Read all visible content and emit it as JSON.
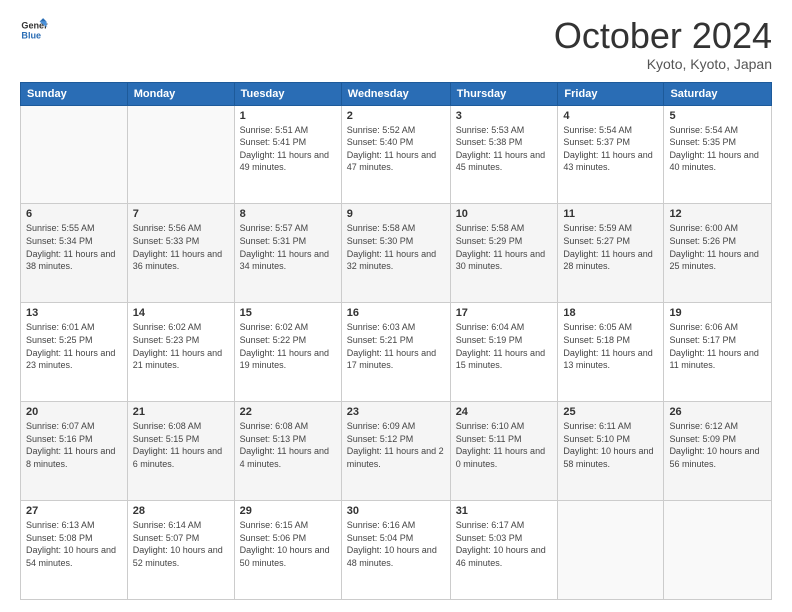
{
  "logo": {
    "line1": "General",
    "line2": "Blue"
  },
  "header": {
    "month": "October 2024",
    "location": "Kyoto, Kyoto, Japan"
  },
  "weekdays": [
    "Sunday",
    "Monday",
    "Tuesday",
    "Wednesday",
    "Thursday",
    "Friday",
    "Saturday"
  ],
  "weeks": [
    [
      {
        "day": "",
        "content": ""
      },
      {
        "day": "",
        "content": ""
      },
      {
        "day": "1",
        "content": "Sunrise: 5:51 AM\nSunset: 5:41 PM\nDaylight: 11 hours and 49 minutes."
      },
      {
        "day": "2",
        "content": "Sunrise: 5:52 AM\nSunset: 5:40 PM\nDaylight: 11 hours and 47 minutes."
      },
      {
        "day": "3",
        "content": "Sunrise: 5:53 AM\nSunset: 5:38 PM\nDaylight: 11 hours and 45 minutes."
      },
      {
        "day": "4",
        "content": "Sunrise: 5:54 AM\nSunset: 5:37 PM\nDaylight: 11 hours and 43 minutes."
      },
      {
        "day": "5",
        "content": "Sunrise: 5:54 AM\nSunset: 5:35 PM\nDaylight: 11 hours and 40 minutes."
      }
    ],
    [
      {
        "day": "6",
        "content": "Sunrise: 5:55 AM\nSunset: 5:34 PM\nDaylight: 11 hours and 38 minutes."
      },
      {
        "day": "7",
        "content": "Sunrise: 5:56 AM\nSunset: 5:33 PM\nDaylight: 11 hours and 36 minutes."
      },
      {
        "day": "8",
        "content": "Sunrise: 5:57 AM\nSunset: 5:31 PM\nDaylight: 11 hours and 34 minutes."
      },
      {
        "day": "9",
        "content": "Sunrise: 5:58 AM\nSunset: 5:30 PM\nDaylight: 11 hours and 32 minutes."
      },
      {
        "day": "10",
        "content": "Sunrise: 5:58 AM\nSunset: 5:29 PM\nDaylight: 11 hours and 30 minutes."
      },
      {
        "day": "11",
        "content": "Sunrise: 5:59 AM\nSunset: 5:27 PM\nDaylight: 11 hours and 28 minutes."
      },
      {
        "day": "12",
        "content": "Sunrise: 6:00 AM\nSunset: 5:26 PM\nDaylight: 11 hours and 25 minutes."
      }
    ],
    [
      {
        "day": "13",
        "content": "Sunrise: 6:01 AM\nSunset: 5:25 PM\nDaylight: 11 hours and 23 minutes."
      },
      {
        "day": "14",
        "content": "Sunrise: 6:02 AM\nSunset: 5:23 PM\nDaylight: 11 hours and 21 minutes."
      },
      {
        "day": "15",
        "content": "Sunrise: 6:02 AM\nSunset: 5:22 PM\nDaylight: 11 hours and 19 minutes."
      },
      {
        "day": "16",
        "content": "Sunrise: 6:03 AM\nSunset: 5:21 PM\nDaylight: 11 hours and 17 minutes."
      },
      {
        "day": "17",
        "content": "Sunrise: 6:04 AM\nSunset: 5:19 PM\nDaylight: 11 hours and 15 minutes."
      },
      {
        "day": "18",
        "content": "Sunrise: 6:05 AM\nSunset: 5:18 PM\nDaylight: 11 hours and 13 minutes."
      },
      {
        "day": "19",
        "content": "Sunrise: 6:06 AM\nSunset: 5:17 PM\nDaylight: 11 hours and 11 minutes."
      }
    ],
    [
      {
        "day": "20",
        "content": "Sunrise: 6:07 AM\nSunset: 5:16 PM\nDaylight: 11 hours and 8 minutes."
      },
      {
        "day": "21",
        "content": "Sunrise: 6:08 AM\nSunset: 5:15 PM\nDaylight: 11 hours and 6 minutes."
      },
      {
        "day": "22",
        "content": "Sunrise: 6:08 AM\nSunset: 5:13 PM\nDaylight: 11 hours and 4 minutes."
      },
      {
        "day": "23",
        "content": "Sunrise: 6:09 AM\nSunset: 5:12 PM\nDaylight: 11 hours and 2 minutes."
      },
      {
        "day": "24",
        "content": "Sunrise: 6:10 AM\nSunset: 5:11 PM\nDaylight: 11 hours and 0 minutes."
      },
      {
        "day": "25",
        "content": "Sunrise: 6:11 AM\nSunset: 5:10 PM\nDaylight: 10 hours and 58 minutes."
      },
      {
        "day": "26",
        "content": "Sunrise: 6:12 AM\nSunset: 5:09 PM\nDaylight: 10 hours and 56 minutes."
      }
    ],
    [
      {
        "day": "27",
        "content": "Sunrise: 6:13 AM\nSunset: 5:08 PM\nDaylight: 10 hours and 54 minutes."
      },
      {
        "day": "28",
        "content": "Sunrise: 6:14 AM\nSunset: 5:07 PM\nDaylight: 10 hours and 52 minutes."
      },
      {
        "day": "29",
        "content": "Sunrise: 6:15 AM\nSunset: 5:06 PM\nDaylight: 10 hours and 50 minutes."
      },
      {
        "day": "30",
        "content": "Sunrise: 6:16 AM\nSunset: 5:04 PM\nDaylight: 10 hours and 48 minutes."
      },
      {
        "day": "31",
        "content": "Sunrise: 6:17 AM\nSunset: 5:03 PM\nDaylight: 10 hours and 46 minutes."
      },
      {
        "day": "",
        "content": ""
      },
      {
        "day": "",
        "content": ""
      }
    ]
  ]
}
